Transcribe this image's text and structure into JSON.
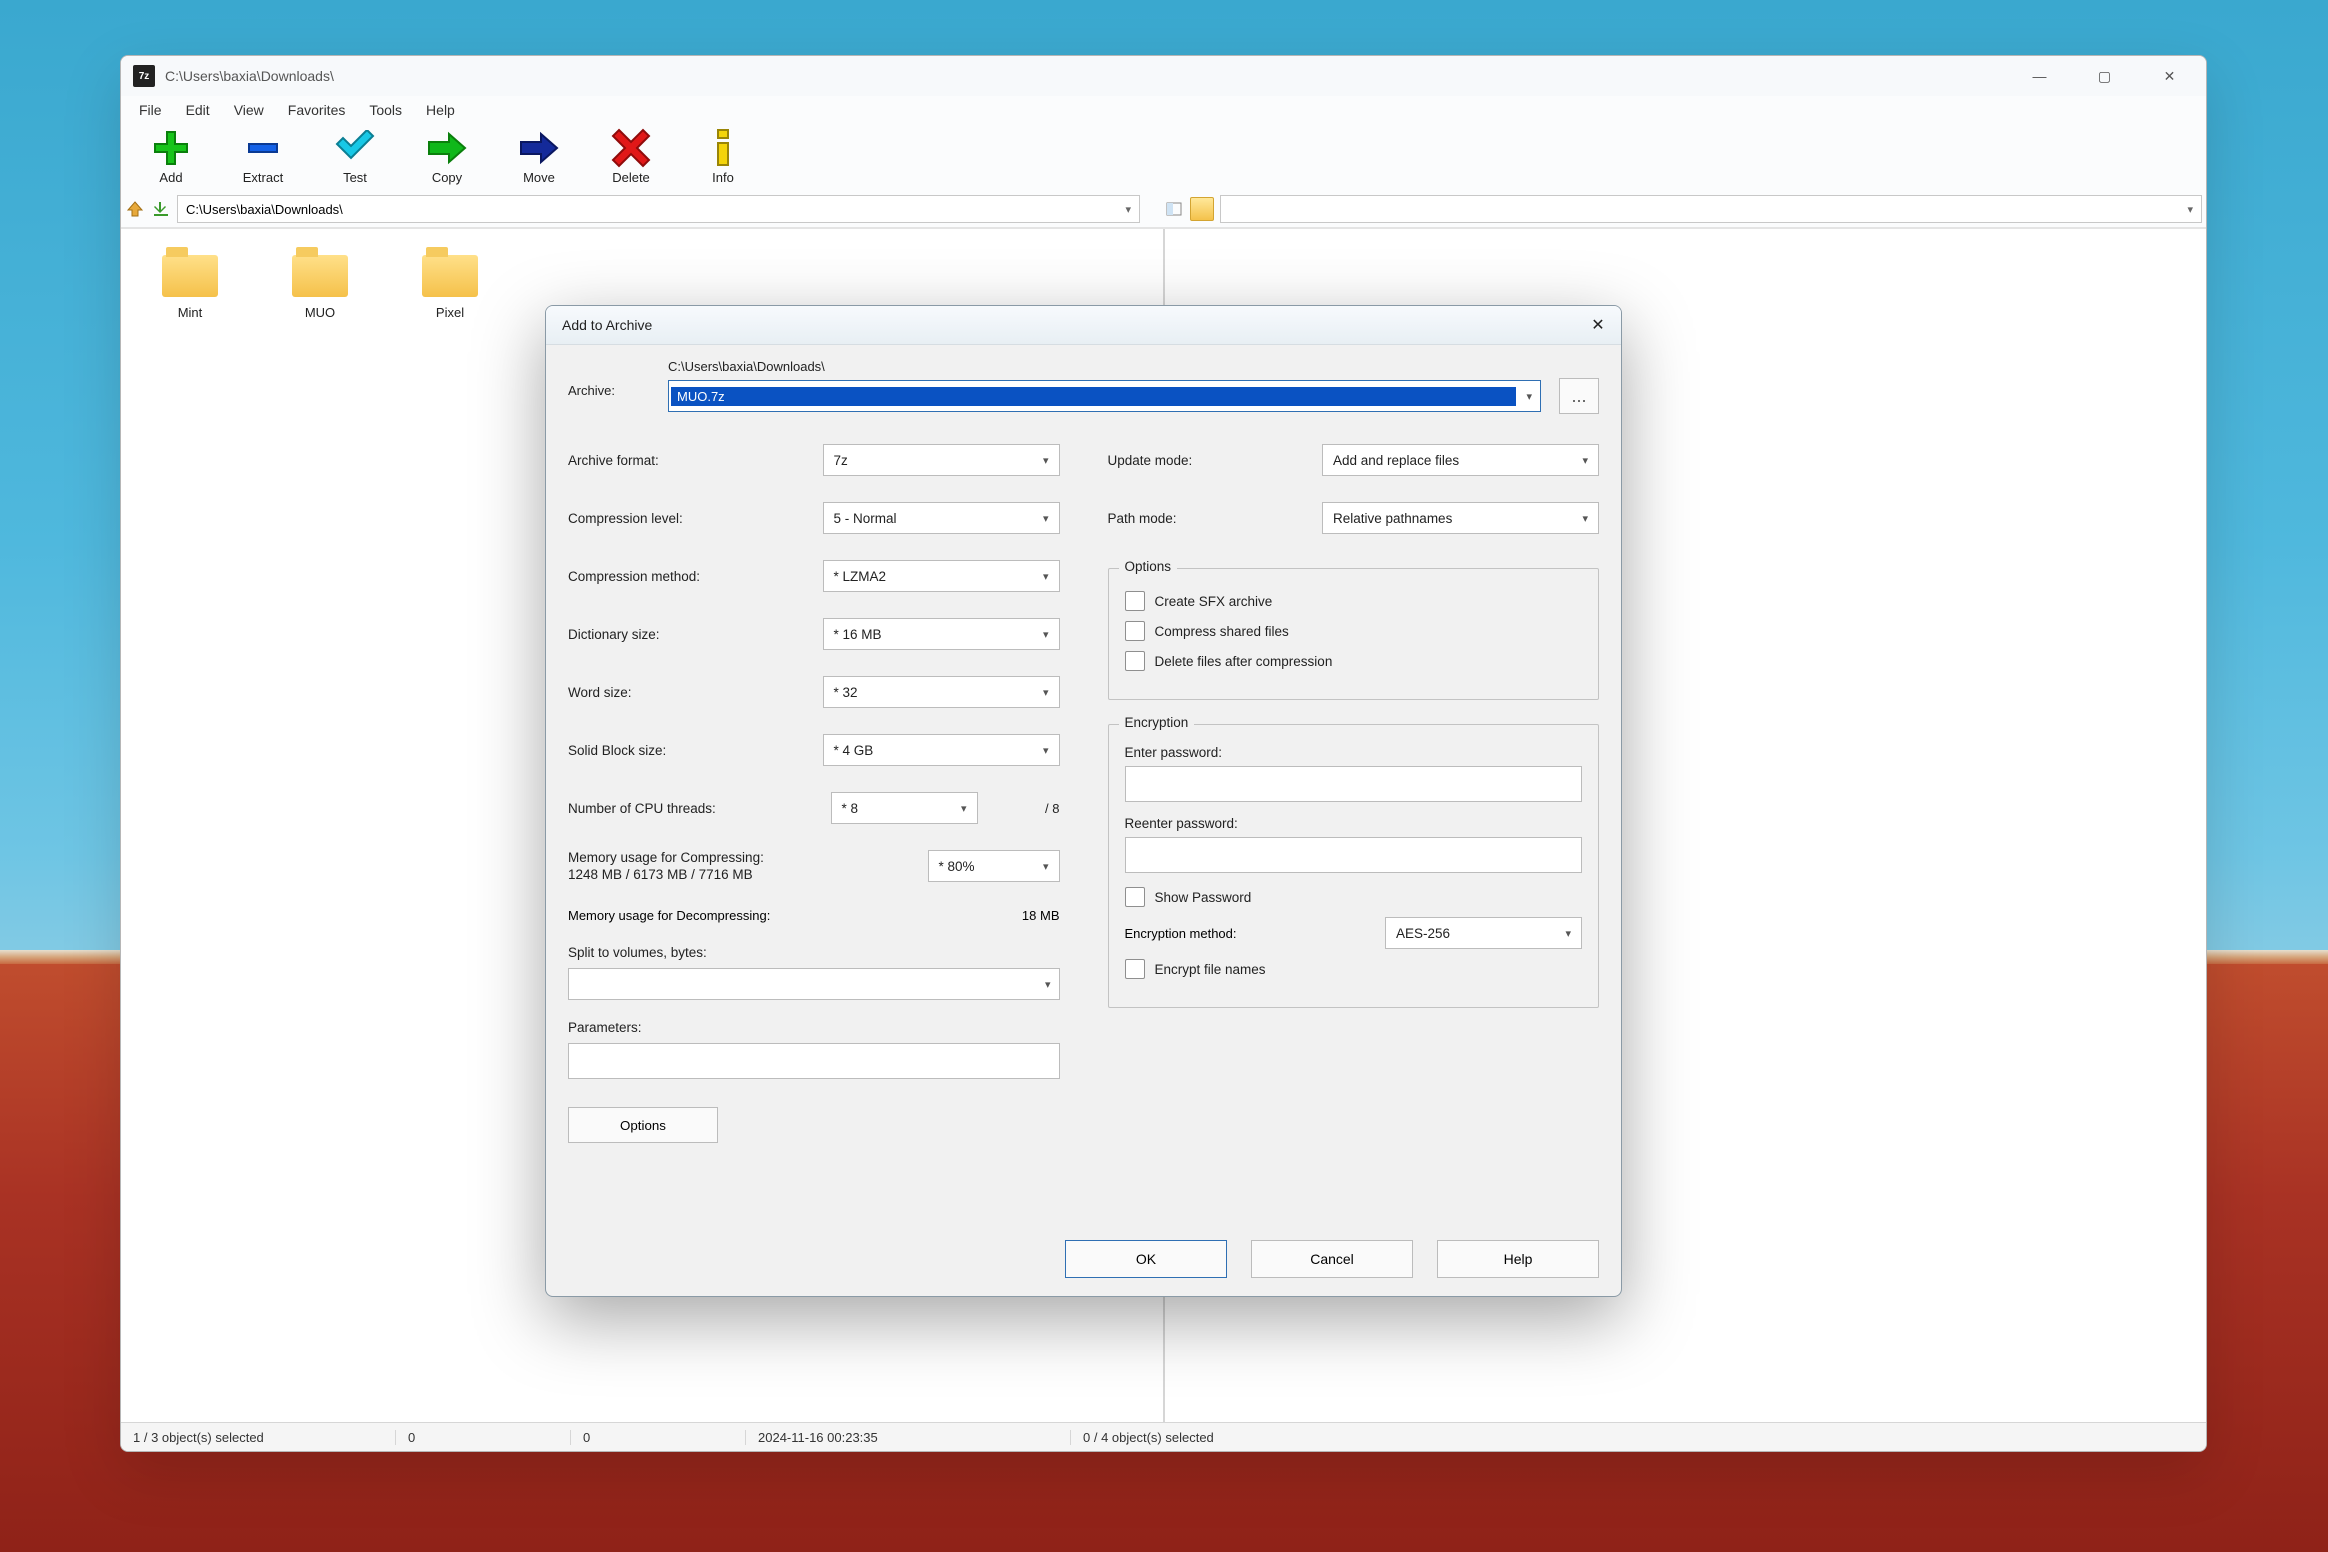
{
  "window": {
    "title": "C:\\Users\\baxia\\Downloads\\",
    "app_glyph": "7z"
  },
  "menu": [
    "File",
    "Edit",
    "View",
    "Favorites",
    "Tools",
    "Help"
  ],
  "toolbar": {
    "add": "Add",
    "extract": "Extract",
    "test": "Test",
    "copy": "Copy",
    "move": "Move",
    "delete": "Delete",
    "info": "Info"
  },
  "address": {
    "left": "C:\\Users\\baxia\\Downloads\\",
    "right": ""
  },
  "folders": [
    "Mint",
    "MUO",
    "Pixel"
  ],
  "status": {
    "left_sel": "1 / 3 object(s) selected",
    "c1": "0",
    "c2": "0",
    "timestamp": "2024-11-16 00:23:35",
    "right_sel": "0 / 4 object(s) selected"
  },
  "dialog": {
    "title": "Add to Archive",
    "archive_label": "Archive:",
    "archive_path": "C:\\Users\\baxia\\Downloads\\",
    "archive_file": "MUO.7z",
    "browse": "...",
    "archive_format_label": "Archive format:",
    "archive_format": "7z",
    "compression_level_label": "Compression level:",
    "compression_level": "5 - Normal",
    "compression_method_label": "Compression method:",
    "compression_method": "*  LZMA2",
    "dictionary_size_label": "Dictionary size:",
    "dictionary_size": "*  16 MB",
    "word_size_label": "Word size:",
    "word_size": "*  32",
    "solid_block_label": "Solid Block size:",
    "solid_block": "*  4 GB",
    "cpu_threads_label": "Number of CPU threads:",
    "cpu_threads": "*  8",
    "cpu_threads_of": "/ 8",
    "mem_compress_label": "Memory usage for Compressing:",
    "mem_compress_detail": "1248 MB / 6173 MB / 7716 MB",
    "mem_compress_pct": "*  80%",
    "mem_decompress_label": "Memory usage for Decompressing:",
    "mem_decompress": "18 MB",
    "split_label": "Split to volumes, bytes:",
    "parameters_label": "Parameters:",
    "options_btn": "Options",
    "update_mode_label": "Update mode:",
    "update_mode": "Add and replace files",
    "path_mode_label": "Path mode:",
    "path_mode": "Relative pathnames",
    "options_legend": "Options",
    "opt_sfx": "Create SFX archive",
    "opt_shared": "Compress shared files",
    "opt_delete": "Delete files after compression",
    "encryption_legend": "Encryption",
    "enter_pwd": "Enter password:",
    "reenter_pwd": "Reenter password:",
    "show_pwd": "Show Password",
    "enc_method_label": "Encryption method:",
    "enc_method": "AES-256",
    "encrypt_names": "Encrypt file names",
    "ok": "OK",
    "cancel": "Cancel",
    "help": "Help"
  }
}
